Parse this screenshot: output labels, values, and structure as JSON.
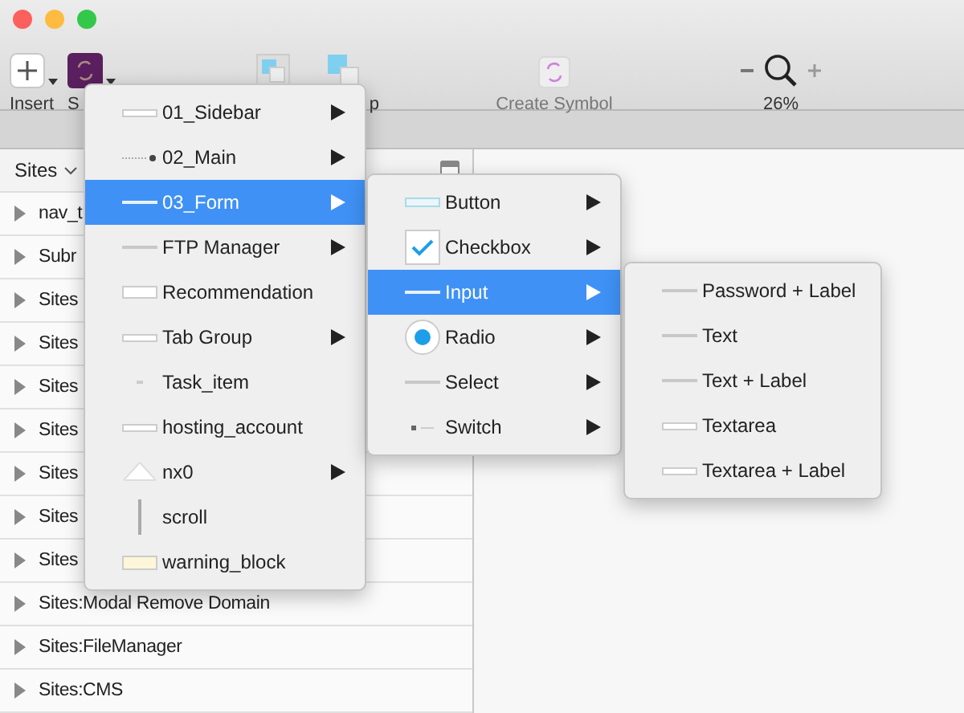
{
  "toolbar": [
    {
      "kind": "insert",
      "label": "Insert"
    },
    {
      "kind": "symbols",
      "label": "S"
    },
    {
      "kind": "group"
    },
    {
      "kind": "ungroup",
      "label": "p"
    },
    {
      "kind": "create",
      "label": "Create Symbol"
    },
    {
      "kind": "zoom",
      "label": "26%"
    }
  ],
  "layers": {
    "header": "Sites",
    "rows": [
      "nav_t",
      "Subr",
      "Sites",
      "Sites",
      "Sites",
      "Sites",
      "Sites",
      "Sites",
      "Sites",
      "Sites:Modal Remove Domain",
      "Sites:FileManager",
      "Sites:CMS"
    ]
  },
  "menus": [
    {
      "items": [
        {
          "label": "01_Sidebar",
          "kind": "bar",
          "submenu": true,
          "selected": false
        },
        {
          "label": "02_Main",
          "kind": "dotline",
          "submenu": true,
          "selected": false
        },
        {
          "label": "03_Form",
          "kind": "line",
          "submenu": true,
          "selected": true
        },
        {
          "label": "FTP Manager",
          "kind": "line",
          "submenu": true,
          "selected": false
        },
        {
          "label": "Recommendation",
          "kind": "box",
          "submenu": false,
          "selected": false
        },
        {
          "label": "Tab Group",
          "kind": "bar",
          "submenu": true,
          "selected": false
        },
        {
          "label": "Task_item",
          "kind": "faint",
          "submenu": false,
          "selected": false
        },
        {
          "label": "hosting_account",
          "kind": "bar",
          "submenu": false,
          "selected": false
        },
        {
          "label": "nx0",
          "kind": "triangle",
          "submenu": true,
          "selected": false
        },
        {
          "label": "scroll",
          "kind": "vline",
          "submenu": false,
          "selected": false
        },
        {
          "label": "warning_block",
          "kind": "note",
          "submenu": false,
          "selected": false
        }
      ]
    },
    {
      "items": [
        {
          "label": "Button",
          "kind": "button",
          "submenu": true,
          "selected": false
        },
        {
          "label": "Checkbox",
          "kind": "checkbox",
          "submenu": true,
          "selected": false
        },
        {
          "label": "Input",
          "kind": "line",
          "submenu": true,
          "selected": true
        },
        {
          "label": "Radio",
          "kind": "radio",
          "submenu": true,
          "selected": false
        },
        {
          "label": "Select",
          "kind": "line",
          "submenu": true,
          "selected": false
        },
        {
          "label": "Switch",
          "kind": "switch",
          "submenu": true,
          "selected": false
        }
      ]
    },
    {
      "items": [
        {
          "label": "Password + Label",
          "kind": "line",
          "submenu": false,
          "selected": false
        },
        {
          "label": "Text",
          "kind": "line",
          "submenu": false,
          "selected": false
        },
        {
          "label": "Text + Label",
          "kind": "line",
          "submenu": false,
          "selected": false
        },
        {
          "label": "Textarea",
          "kind": "bar",
          "submenu": false,
          "selected": false
        },
        {
          "label": "Textarea + Label",
          "kind": "bar",
          "submenu": false,
          "selected": false
        }
      ]
    }
  ]
}
